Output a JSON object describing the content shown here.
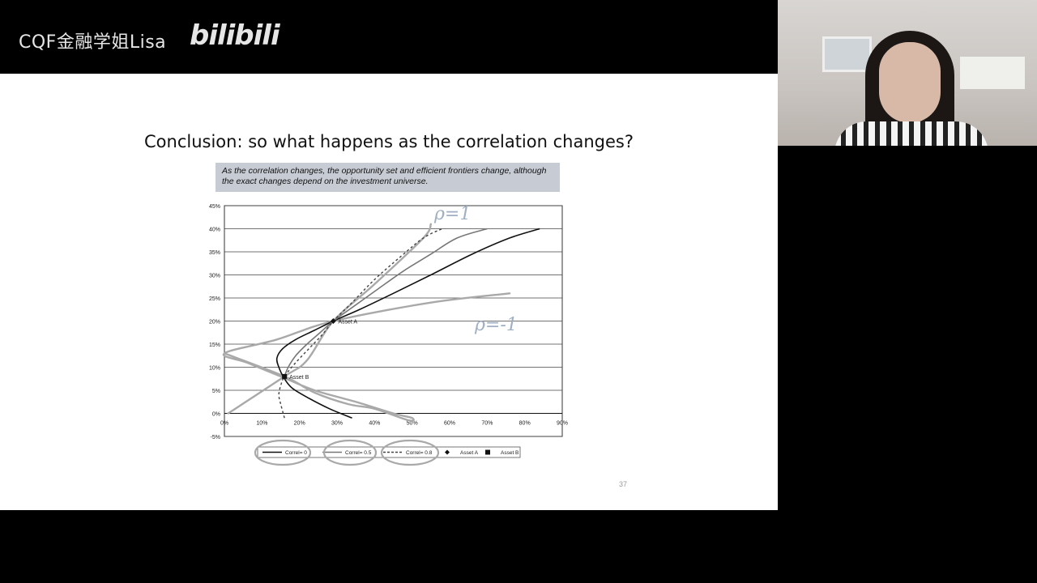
{
  "header": {
    "channel": "CQF金融学姐Lisa",
    "platform": "bilibili"
  },
  "slide": {
    "title": "Conclusion: so what happens as the correlation changes?",
    "callout": "As the correlation changes, the opportunity set and efficient frontiers change, although the exact changes depend on the investment universe.",
    "page_number": "37"
  },
  "chart_data": {
    "type": "line",
    "title": "",
    "xlabel": "",
    "ylabel": "",
    "xlim": [
      0,
      90
    ],
    "ylim": [
      -5,
      45
    ],
    "x_ticks": [
      "0%",
      "10%",
      "20%",
      "30%",
      "40%",
      "50%",
      "60%",
      "70%",
      "80%",
      "90%"
    ],
    "y_ticks": [
      "45%",
      "40%",
      "35%",
      "30%",
      "25%",
      "20%",
      "15%",
      "10%",
      "5%",
      "0%",
      "-5%"
    ],
    "grid": "horizontal",
    "legend_position": "bottom",
    "colors": {
      "correl_0": "#111111",
      "correl_05": "#777777",
      "correl_08": "#444444",
      "handdrawn": "#a9a9a9",
      "annotation": "#9fb0c4"
    },
    "series": [
      {
        "name": "Correl= 0",
        "style": "solid",
        "points": [
          [
            34,
            -1
          ],
          [
            28,
            1
          ],
          [
            22,
            3.5
          ],
          [
            18,
            5.5
          ],
          [
            16,
            7.5
          ],
          [
            14.5,
            10
          ],
          [
            14,
            12
          ],
          [
            15.5,
            14
          ],
          [
            19,
            16
          ],
          [
            24,
            18
          ],
          [
            29,
            20
          ],
          [
            36,
            22.5
          ],
          [
            45,
            26
          ],
          [
            55,
            30
          ],
          [
            66,
            34.5
          ],
          [
            76,
            38
          ],
          [
            84,
            40
          ]
        ]
      },
      {
        "name": "Correl= 0.5",
        "style": "solid",
        "points": [
          [
            16,
            8
          ],
          [
            17,
            10
          ],
          [
            19,
            12.5
          ],
          [
            22,
            15
          ],
          [
            25.5,
            17.5
          ],
          [
            29,
            20
          ],
          [
            35,
            23.5
          ],
          [
            41,
            27
          ],
          [
            48,
            31
          ],
          [
            55,
            34.5
          ],
          [
            62,
            38
          ],
          [
            70,
            40
          ]
        ]
      },
      {
        "name": "Correl= 0.8",
        "style": "dashed",
        "points": [
          [
            16,
            -1
          ],
          [
            15,
            2
          ],
          [
            14.5,
            4
          ],
          [
            15,
            6
          ],
          [
            16,
            8
          ],
          [
            19,
            11
          ],
          [
            22.5,
            14
          ],
          [
            26,
            17
          ],
          [
            29,
            20
          ],
          [
            34,
            24
          ],
          [
            40,
            29
          ],
          [
            47,
            34
          ],
          [
            53,
            38
          ],
          [
            58,
            40
          ]
        ]
      },
      {
        "name": "ρ=1 (drawn)",
        "style": "handdrawn",
        "points": [
          [
            1,
            0
          ],
          [
            16,
            8
          ],
          [
            22,
            11.5
          ],
          [
            29,
            20
          ],
          [
            40,
            28
          ],
          [
            53,
            38
          ],
          [
            55,
            41
          ]
        ]
      },
      {
        "name": "ρ=-1 (drawn)",
        "style": "handdrawn",
        "points": [
          [
            0,
            13
          ],
          [
            16,
            8
          ],
          [
            24,
            4.5
          ],
          [
            33,
            2
          ],
          [
            40,
            1
          ],
          [
            49,
            -1.5
          ],
          [
            50,
            -1
          ],
          [
            45,
            0
          ],
          [
            35,
            2.5
          ],
          [
            24,
            5
          ],
          [
            15,
            8
          ],
          [
            6,
            11
          ],
          [
            0,
            13
          ],
          [
            14,
            16
          ],
          [
            29,
            20
          ],
          [
            55,
            24
          ],
          [
            76,
            26
          ]
        ]
      }
    ],
    "markers": [
      {
        "name": "Asset A",
        "x": 29,
        "y": 20,
        "symbol": "diamond"
      },
      {
        "name": "Asset B",
        "x": 16,
        "y": 8,
        "symbol": "square"
      }
    ],
    "legend": [
      "Correl= 0",
      "Correl= 0.5",
      "Correl= 0.8",
      "Asset A",
      "Asset B"
    ],
    "annotations": [
      "ρ=1",
      "ρ=-1"
    ]
  }
}
